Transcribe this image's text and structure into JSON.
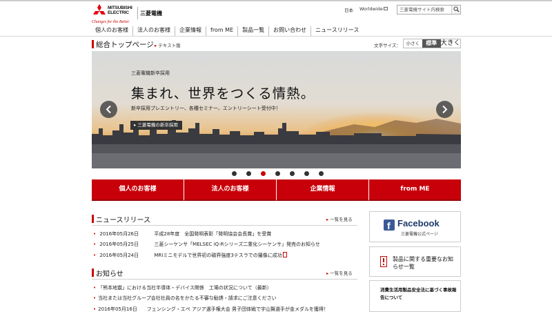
{
  "header": {
    "logo_word": "MITSUBISHI ELECTRIC",
    "logo_jp": "三菱電機",
    "tagline": "Changes for the Better",
    "lang_label": "日本",
    "worldwide_label": "Worldwide",
    "search_placeholder": "三菱電機サイト内検索"
  },
  "global_nav": [
    "個人のお客様",
    "法人のお客様",
    "企業情報",
    "from ME",
    "製品一覧",
    "お問い合わせ",
    "ニュースリリース"
  ],
  "page": {
    "title": "総合トップページ",
    "text_version": "テキスト版",
    "font_size_label": "文字サイズ：",
    "font_sizes": {
      "small": "小さく",
      "standard": "標準",
      "large": "大きく"
    }
  },
  "hero": {
    "small_text": "三菱電機新卒採用",
    "headline": "集まれ、世界をつくる情熱。",
    "sub_text": "新卒採用プレエントリー、各種セミナー、エントリーシート受付中！",
    "cta_label": "三菱電機の新卒採用",
    "slide_count": 7,
    "active_slide": 3
  },
  "red_nav": [
    "個人のお客様",
    "法人のお客様",
    "企業情報",
    "from ME"
  ],
  "news": {
    "title": "ニュースリリース",
    "more_label": "一覧を見る",
    "items": [
      {
        "date": "2016年05月26日",
        "text": "平成28年度　全国発明表彰「発明協会会長賞」を受賞"
      },
      {
        "date": "2016年05月25日",
        "text": "三菱シーケンサ「MELSEC iQ-Rシリーズ二重化シーケンサ」発売のお知らせ"
      },
      {
        "date": "2016年05月24日",
        "text": "MRIミニモデルで世界初の磁界強度3テスラでの撮像に成功"
      }
    ]
  },
  "info": {
    "title": "お知らせ",
    "more_label": "一覧を見る",
    "items": [
      "「熊本地震」における当社半導体・デバイス関係　工場の状況について（最新）",
      "当社または当社グループ会社社員の名をかたる不審な勧誘・請求にご注意ください",
      "2016年05月16日　　フェンシング・エペ アジア選手権大会 男子団体戦で宇山賢選手が金メダルを獲得！"
    ]
  },
  "sidebar": {
    "facebook_word": "Facebook",
    "facebook_sub": "三菱電機公式ページ",
    "notice_text": "製品に関する重要なお知らせ一覧",
    "safety_text": "消費生活用製品安全法に基づく事故報告について"
  },
  "colors": {
    "brand_red": "#c8000a",
    "facebook_blue": "#3b5998"
  }
}
